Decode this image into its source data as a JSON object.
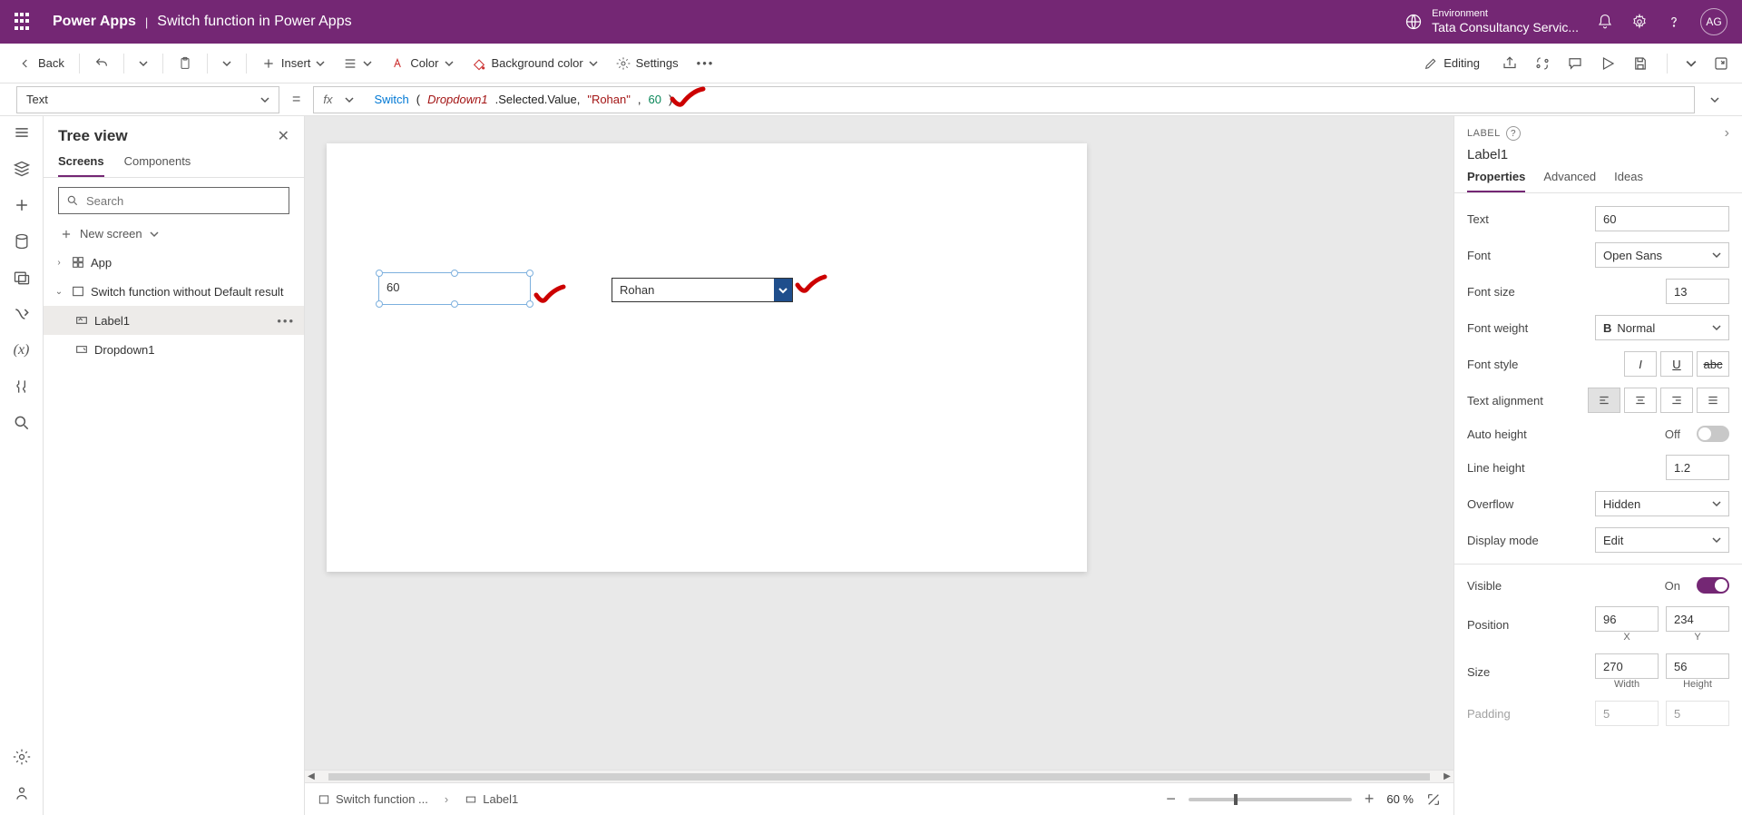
{
  "header": {
    "app": "Power Apps",
    "page": "Switch function in Power Apps",
    "env_label": "Environment",
    "env_value": "Tata Consultancy Servic...",
    "avatar": "AG"
  },
  "toolbar": {
    "back": "Back",
    "insert": "Insert",
    "color": "Color",
    "bgcolor": "Background color",
    "settings": "Settings",
    "editing": "Editing"
  },
  "formula": {
    "property": "Text",
    "fx": "fx",
    "func": "Switch",
    "open": "(",
    "obj": "Dropdown1",
    "chain": ".Selected.Value,",
    "str": "\"Rohan\"",
    "comma": ", ",
    "num": "60",
    "close": ")"
  },
  "tree": {
    "title": "Tree view",
    "tab_screens": "Screens",
    "tab_components": "Components",
    "search_ph": "Search",
    "new_screen": "New screen",
    "app": "App",
    "screen": "Switch function without Default result",
    "label": "Label1",
    "dropdown": "Dropdown1"
  },
  "canvas": {
    "label_value": "60",
    "dropdown_value": "Rohan"
  },
  "status": {
    "bc1": "Switch function ...",
    "bc2": "Label1",
    "zoom": "60  %"
  },
  "props": {
    "panel_type": "LABEL",
    "el_name": "Label1",
    "tab_props": "Properties",
    "tab_adv": "Advanced",
    "tab_ideas": "Ideas",
    "text_lbl": "Text",
    "text_val": "60",
    "font_lbl": "Font",
    "font_val": "Open Sans",
    "fs_lbl": "Font size",
    "fs_val": "13",
    "fw_lbl": "Font weight",
    "fw_val": "Normal",
    "fw_b": "B",
    "fstyle_lbl": "Font style",
    "talign_lbl": "Text alignment",
    "ah_lbl": "Auto height",
    "ah_val": "Off",
    "lh_lbl": "Line height",
    "lh_val": "1.2",
    "of_lbl": "Overflow",
    "of_val": "Hidden",
    "dm_lbl": "Display mode",
    "dm_val": "Edit",
    "vis_lbl": "Visible",
    "vis_val": "On",
    "pos_lbl": "Position",
    "pos_x": "96",
    "pos_y": "234",
    "pos_xl": "X",
    "pos_yl": "Y",
    "size_lbl": "Size",
    "size_w": "270",
    "size_h": "56",
    "size_wl": "Width",
    "size_hl": "Height",
    "pad_lbl": "Padding",
    "pad_a": "5",
    "pad_b": "5"
  }
}
